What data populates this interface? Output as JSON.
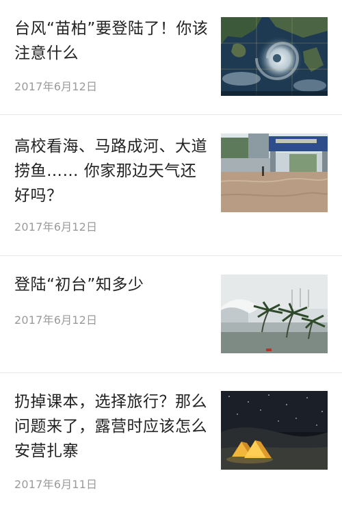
{
  "articles": [
    {
      "title": "台风“苗柏”要登陆了！你该注意什么",
      "date": "2017年6月12日",
      "thumbnail": "satellite-typhoon-image"
    },
    {
      "title": "高校看海、马路成河、大道捞鱼…… 你家那边天气还好吗？",
      "date": "2017年6月12日",
      "thumbnail": "flooded-campus-street-image"
    },
    {
      "title": "登陆“初台”知多少",
      "date": "2017年6月12日",
      "thumbnail": "storm-waves-palm-trees-image"
    },
    {
      "title": "扔掉课本，选择旅行？那么问题来了，露营时应该怎么安营扎寨",
      "date": "2017年6月11日",
      "thumbnail": "night-camping-tents-image"
    }
  ]
}
